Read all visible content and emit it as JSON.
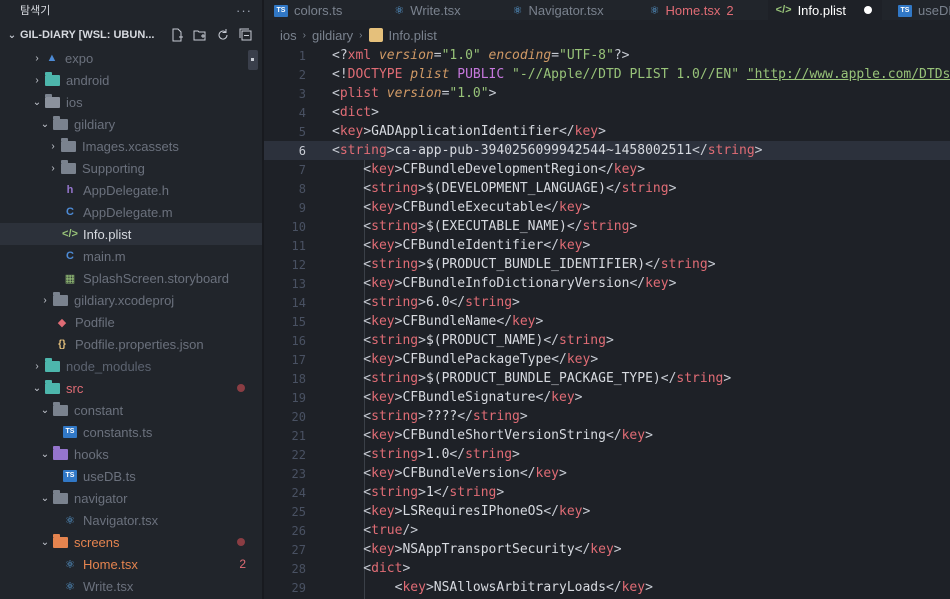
{
  "sidebar": {
    "title": "탐색기",
    "more": "···",
    "project": "GIL-DIARY [WSL: UBUN...",
    "items": [
      {
        "label": "expo",
        "icon": "expo-folder-icon"
      },
      {
        "label": "android",
        "icon": "android-folder-icon"
      },
      {
        "label": "ios",
        "icon": "ios-folder-icon"
      },
      {
        "label": "gildiary",
        "icon": "folder-icon"
      },
      {
        "label": "Images.xcassets",
        "icon": "folder-icon"
      },
      {
        "label": "Supporting",
        "icon": "folder-icon"
      },
      {
        "label": "AppDelegate.h",
        "icon": "h-file-icon"
      },
      {
        "label": "AppDelegate.m",
        "icon": "c-file-icon"
      },
      {
        "label": "Info.plist",
        "icon": "plist-file-icon"
      },
      {
        "label": "main.m",
        "icon": "c-file-icon"
      },
      {
        "label": "SplashScreen.storyboard",
        "icon": "storyboard-file-icon"
      },
      {
        "label": "gildiary.xcodeproj",
        "icon": "folder-icon"
      },
      {
        "label": "Podfile",
        "icon": "ruby-file-icon"
      },
      {
        "label": "Podfile.properties.json",
        "icon": "json-file-icon"
      },
      {
        "label": "node_modules",
        "icon": "node-folder-icon"
      },
      {
        "label": "src",
        "icon": "src-folder-icon"
      },
      {
        "label": "constant",
        "icon": "folder-icon"
      },
      {
        "label": "constants.ts",
        "icon": "ts-file-icon"
      },
      {
        "label": "hooks",
        "icon": "hooks-folder-icon"
      },
      {
        "label": "useDB.ts",
        "icon": "ts-file-icon"
      },
      {
        "label": "navigator",
        "icon": "folder-icon"
      },
      {
        "label": "Navigator.tsx",
        "icon": "react-file-icon"
      },
      {
        "label": "screens",
        "icon": "screens-folder-icon"
      },
      {
        "label": "Home.tsx",
        "icon": "react-file-icon",
        "badge": "2"
      },
      {
        "label": "Write.tsx",
        "icon": "react-file-icon"
      }
    ]
  },
  "tabs": [
    {
      "label": "colors.ts"
    },
    {
      "label": "Write.tsx"
    },
    {
      "label": "Navigator.tsx"
    },
    {
      "label": "Home.tsx",
      "count": "2"
    },
    {
      "label": "Info.plist",
      "active": true
    },
    {
      "label": "useDB.ts"
    }
  ],
  "breadcrumb": [
    "ios",
    "gildiary",
    "Info.plist"
  ],
  "editor": {
    "current_line": 6,
    "lines": [
      {
        "n": "1",
        "parts": [
          [
            "p",
            "<?"
          ],
          [
            "t",
            "xml"
          ],
          [
            "a",
            " version"
          ],
          [
            "p",
            "="
          ],
          [
            "s",
            "\"1.0\""
          ],
          [
            "a",
            " encoding"
          ],
          [
            "p",
            "="
          ],
          [
            "s",
            "\"UTF-8\""
          ],
          [
            "p",
            "?>"
          ]
        ]
      },
      {
        "n": "2",
        "parts": [
          [
            "p",
            "<!"
          ],
          [
            "t",
            "DOCTYPE"
          ],
          [
            "a",
            " plist"
          ],
          [
            "kw",
            " PUBLIC"
          ],
          [
            "s",
            " \"-//Apple//DTD PLIST 1.0//EN\""
          ],
          [
            "p",
            " "
          ],
          [
            "u",
            "\"http://www.apple.com/DTDs/P"
          ]
        ]
      },
      {
        "n": "3",
        "parts": [
          [
            "p",
            "<"
          ],
          [
            "t",
            "plist"
          ],
          [
            "a",
            " version"
          ],
          [
            "p",
            "="
          ],
          [
            "s",
            "\"1.0\""
          ],
          [
            "p",
            ">"
          ]
        ]
      },
      {
        "n": "4",
        "parts": [
          [
            "p",
            "<"
          ],
          [
            "t",
            "dict"
          ],
          [
            "p",
            ">"
          ]
        ]
      },
      {
        "n": "5",
        "parts": [
          [
            "p",
            "<"
          ],
          [
            "t",
            "key"
          ],
          [
            "p",
            ">"
          ],
          [
            "txt",
            "GADApplicationIdentifier"
          ],
          [
            "p",
            "</"
          ],
          [
            "t",
            "key"
          ],
          [
            "p",
            ">"
          ]
        ]
      },
      {
        "n": "6",
        "parts": [
          [
            "p",
            "<"
          ],
          [
            "t",
            "string"
          ],
          [
            "p",
            ">"
          ],
          [
            "txt",
            "ca-app-pub-3940256099942544~1458002511"
          ],
          [
            "p",
            "</"
          ],
          [
            "t",
            "string"
          ],
          [
            "p",
            ">"
          ]
        ]
      },
      {
        "n": "7",
        "parts": [
          [
            "p",
            "    <"
          ],
          [
            "t",
            "key"
          ],
          [
            "p",
            ">"
          ],
          [
            "txt",
            "CFBundleDevelopmentRegion"
          ],
          [
            "p",
            "</"
          ],
          [
            "t",
            "key"
          ],
          [
            "p",
            ">"
          ]
        ]
      },
      {
        "n": "8",
        "parts": [
          [
            "p",
            "    <"
          ],
          [
            "t",
            "string"
          ],
          [
            "p",
            ">"
          ],
          [
            "txt",
            "$(DEVELOPMENT_LANGUAGE)"
          ],
          [
            "p",
            "</"
          ],
          [
            "t",
            "string"
          ],
          [
            "p",
            ">"
          ]
        ]
      },
      {
        "n": "9",
        "parts": [
          [
            "p",
            "    <"
          ],
          [
            "t",
            "key"
          ],
          [
            "p",
            ">"
          ],
          [
            "txt",
            "CFBundleExecutable"
          ],
          [
            "p",
            "</"
          ],
          [
            "t",
            "key"
          ],
          [
            "p",
            ">"
          ]
        ]
      },
      {
        "n": "10",
        "parts": [
          [
            "p",
            "    <"
          ],
          [
            "t",
            "string"
          ],
          [
            "p",
            ">"
          ],
          [
            "txt",
            "$(EXECUTABLE_NAME)"
          ],
          [
            "p",
            "</"
          ],
          [
            "t",
            "string"
          ],
          [
            "p",
            ">"
          ]
        ]
      },
      {
        "n": "11",
        "parts": [
          [
            "p",
            "    <"
          ],
          [
            "t",
            "key"
          ],
          [
            "p",
            ">"
          ],
          [
            "txt",
            "CFBundleIdentifier"
          ],
          [
            "p",
            "</"
          ],
          [
            "t",
            "key"
          ],
          [
            "p",
            ">"
          ]
        ]
      },
      {
        "n": "12",
        "parts": [
          [
            "p",
            "    <"
          ],
          [
            "t",
            "string"
          ],
          [
            "p",
            ">"
          ],
          [
            "txt",
            "$(PRODUCT_BUNDLE_IDENTIFIER)"
          ],
          [
            "p",
            "</"
          ],
          [
            "t",
            "string"
          ],
          [
            "p",
            ">"
          ]
        ]
      },
      {
        "n": "13",
        "parts": [
          [
            "p",
            "    <"
          ],
          [
            "t",
            "key"
          ],
          [
            "p",
            ">"
          ],
          [
            "txt",
            "CFBundleInfoDictionaryVersion"
          ],
          [
            "p",
            "</"
          ],
          [
            "t",
            "key"
          ],
          [
            "p",
            ">"
          ]
        ]
      },
      {
        "n": "14",
        "parts": [
          [
            "p",
            "    <"
          ],
          [
            "t",
            "string"
          ],
          [
            "p",
            ">"
          ],
          [
            "txt",
            "6.0"
          ],
          [
            "p",
            "</"
          ],
          [
            "t",
            "string"
          ],
          [
            "p",
            ">"
          ]
        ]
      },
      {
        "n": "15",
        "parts": [
          [
            "p",
            "    <"
          ],
          [
            "t",
            "key"
          ],
          [
            "p",
            ">"
          ],
          [
            "txt",
            "CFBundleName"
          ],
          [
            "p",
            "</"
          ],
          [
            "t",
            "key"
          ],
          [
            "p",
            ">"
          ]
        ]
      },
      {
        "n": "16",
        "parts": [
          [
            "p",
            "    <"
          ],
          [
            "t",
            "string"
          ],
          [
            "p",
            ">"
          ],
          [
            "txt",
            "$(PRODUCT_NAME)"
          ],
          [
            "p",
            "</"
          ],
          [
            "t",
            "string"
          ],
          [
            "p",
            ">"
          ]
        ]
      },
      {
        "n": "17",
        "parts": [
          [
            "p",
            "    <"
          ],
          [
            "t",
            "key"
          ],
          [
            "p",
            ">"
          ],
          [
            "txt",
            "CFBundlePackageType"
          ],
          [
            "p",
            "</"
          ],
          [
            "t",
            "key"
          ],
          [
            "p",
            ">"
          ]
        ]
      },
      {
        "n": "18",
        "parts": [
          [
            "p",
            "    <"
          ],
          [
            "t",
            "string"
          ],
          [
            "p",
            ">"
          ],
          [
            "txt",
            "$(PRODUCT_BUNDLE_PACKAGE_TYPE)"
          ],
          [
            "p",
            "</"
          ],
          [
            "t",
            "string"
          ],
          [
            "p",
            ">"
          ]
        ]
      },
      {
        "n": "19",
        "parts": [
          [
            "p",
            "    <"
          ],
          [
            "t",
            "key"
          ],
          [
            "p",
            ">"
          ],
          [
            "txt",
            "CFBundleSignature"
          ],
          [
            "p",
            "</"
          ],
          [
            "t",
            "key"
          ],
          [
            "p",
            ">"
          ]
        ]
      },
      {
        "n": "20",
        "parts": [
          [
            "p",
            "    <"
          ],
          [
            "t",
            "string"
          ],
          [
            "p",
            ">"
          ],
          [
            "txt",
            "????"
          ],
          [
            "p",
            "</"
          ],
          [
            "t",
            "string"
          ],
          [
            "p",
            ">"
          ]
        ]
      },
      {
        "n": "21",
        "parts": [
          [
            "p",
            "    <"
          ],
          [
            "t",
            "key"
          ],
          [
            "p",
            ">"
          ],
          [
            "txt",
            "CFBundleShortVersionString"
          ],
          [
            "p",
            "</"
          ],
          [
            "t",
            "key"
          ],
          [
            "p",
            ">"
          ]
        ]
      },
      {
        "n": "22",
        "parts": [
          [
            "p",
            "    <"
          ],
          [
            "t",
            "string"
          ],
          [
            "p",
            ">"
          ],
          [
            "txt",
            "1.0"
          ],
          [
            "p",
            "</"
          ],
          [
            "t",
            "string"
          ],
          [
            "p",
            ">"
          ]
        ]
      },
      {
        "n": "23",
        "parts": [
          [
            "p",
            "    <"
          ],
          [
            "t",
            "key"
          ],
          [
            "p",
            ">"
          ],
          [
            "txt",
            "CFBundleVersion"
          ],
          [
            "p",
            "</"
          ],
          [
            "t",
            "key"
          ],
          [
            "p",
            ">"
          ]
        ]
      },
      {
        "n": "24",
        "parts": [
          [
            "p",
            "    <"
          ],
          [
            "t",
            "string"
          ],
          [
            "p",
            ">"
          ],
          [
            "txt",
            "1"
          ],
          [
            "p",
            "</"
          ],
          [
            "t",
            "string"
          ],
          [
            "p",
            ">"
          ]
        ]
      },
      {
        "n": "25",
        "parts": [
          [
            "p",
            "    <"
          ],
          [
            "t",
            "key"
          ],
          [
            "p",
            ">"
          ],
          [
            "txt",
            "LSRequiresIPhoneOS"
          ],
          [
            "p",
            "</"
          ],
          [
            "t",
            "key"
          ],
          [
            "p",
            ">"
          ]
        ]
      },
      {
        "n": "26",
        "parts": [
          [
            "p",
            "    <"
          ],
          [
            "t",
            "true"
          ],
          [
            "p",
            "/>"
          ]
        ]
      },
      {
        "n": "27",
        "parts": [
          [
            "p",
            "    <"
          ],
          [
            "t",
            "key"
          ],
          [
            "p",
            ">"
          ],
          [
            "txt",
            "NSAppTransportSecurity"
          ],
          [
            "p",
            "</"
          ],
          [
            "t",
            "key"
          ],
          [
            "p",
            ">"
          ]
        ]
      },
      {
        "n": "28",
        "parts": [
          [
            "p",
            "    <"
          ],
          [
            "t",
            "dict"
          ],
          [
            "p",
            ">"
          ]
        ]
      },
      {
        "n": "29",
        "parts": [
          [
            "p",
            "        <"
          ],
          [
            "t",
            "key"
          ],
          [
            "p",
            ">"
          ],
          [
            "txt",
            "NSAllowsArbitraryLoads"
          ],
          [
            "p",
            "</"
          ],
          [
            "t",
            "key"
          ],
          [
            "p",
            ">"
          ]
        ]
      }
    ]
  }
}
